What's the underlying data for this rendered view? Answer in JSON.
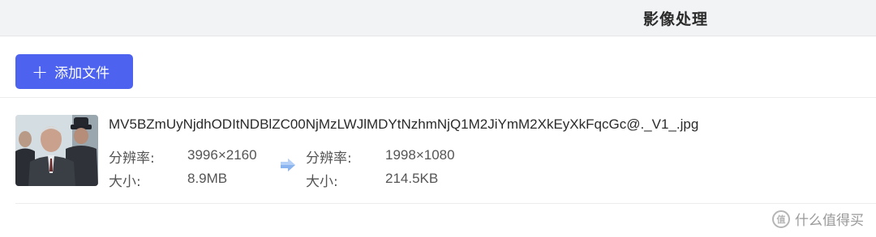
{
  "header": {
    "title": "影像处理"
  },
  "toolbar": {
    "add_file_label": "添加文件"
  },
  "file": {
    "name": "MV5BZmUyNjdhODItNDBlZC00NjMzLWJlMDYtNzhmNjQ1M2JiYmM2XkEyXkFqcGc@._V1_.jpg",
    "before": {
      "resolution_label": "分辨率:",
      "resolution": "3996×2160",
      "size_label": "大小:",
      "size": "8.9MB"
    },
    "after": {
      "resolution_label": "分辨率:",
      "resolution": "1998×1080",
      "size_label": "大小:",
      "size": "214.5KB"
    }
  },
  "watermark": {
    "text": "什么值得买",
    "icon_glyph": "值"
  }
}
